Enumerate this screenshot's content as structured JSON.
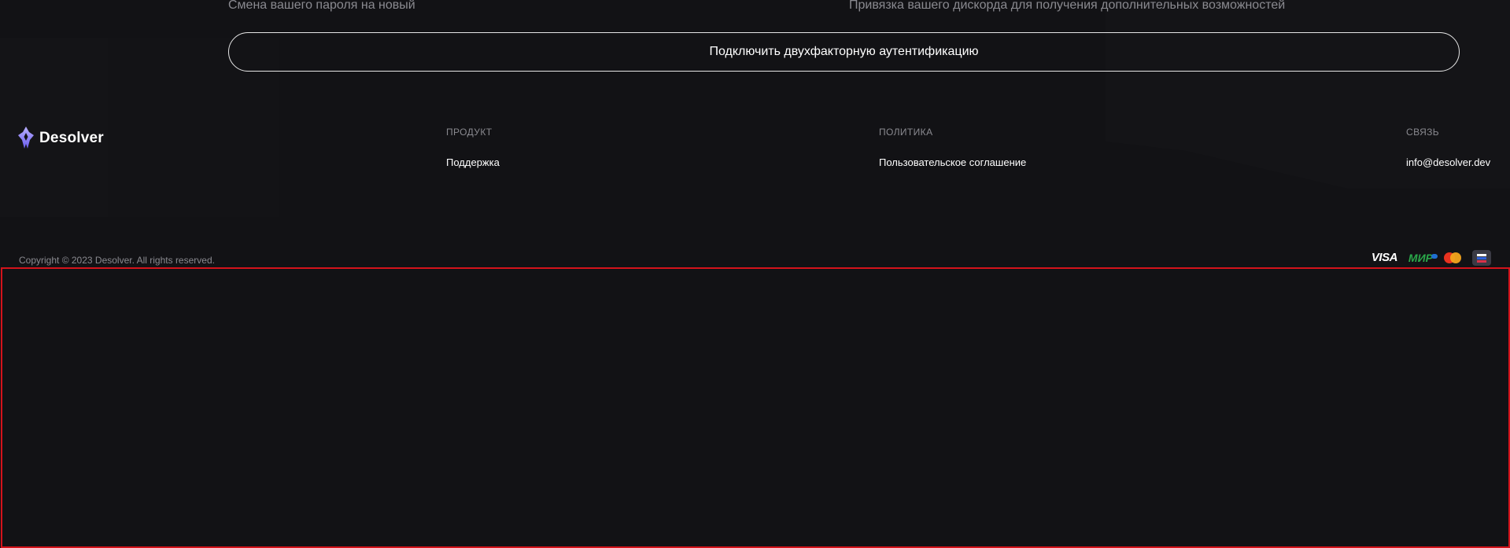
{
  "security": {
    "password_desc": "Смена вашего пароля на новый",
    "discord_desc": "Привязка вашего дискорда для получения дополнительных возможностей",
    "twofa_button_label": "Подключить двухфакторную аутентификацию"
  },
  "footer": {
    "brand_name": "Desolver",
    "columns": {
      "product": {
        "heading": "ПРОДУКТ",
        "links": [
          "Поддержка"
        ]
      },
      "policy": {
        "heading": "ПОЛИТИКА",
        "links": [
          "Пользовательское соглашение"
        ]
      },
      "contact": {
        "heading": "СВЯЗЬ",
        "links": [
          "info@desolver.dev"
        ]
      }
    },
    "copyright": "Copyright © 2023 Desolver. All rights reserved.",
    "payments": {
      "visa": "VISA",
      "mir": "МИР",
      "icons": [
        "visa-icon",
        "mir-icon",
        "mastercard-icon",
        "sbp-icon"
      ]
    }
  },
  "colors": {
    "background": "#121215",
    "accent": "#7b6cf6",
    "muted_text": "#8a8a90",
    "highlight_border": "#d4131b"
  }
}
